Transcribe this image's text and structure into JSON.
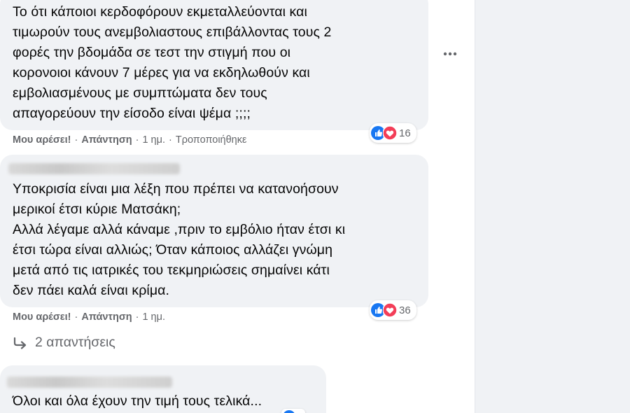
{
  "comments": [
    {
      "text": "Το ότι κάποιοι κερδοφόρουν εκμεταλλεύονται και\nτιμωρούν τους ανεμβολιαστους επιβάλλοντας τους 2\nφορές την βδομάδα σε τεστ την στιγμή που οι\nκορονοιοι κάνουν 7 μέρες για να εκδηλωθούν και\nεμβολιασμένους με συμπτώματα δεν τους\nαπαγορεύουν την είσοδο είναι ψέμα ;;;;",
      "reaction_count": "16",
      "like_label": "Μου αρέσει!",
      "reply_label": "Απάντηση",
      "time": "1 ημ.",
      "edited": "Τροποποιήθηκε"
    },
    {
      "text": "Υποκρισία είναι μια λέξη που πρέπει να κατανοήσουν\nμερικοί έτσι κύριε Ματσάκη;\nΑλλά λέγαμε αλλά κάναμε ,πριν το εμβόλιο ήταν έτσι κι\nέτσι τώρα είναι αλλιώς; Όταν κάποιος αλλάζει γνώμη\nμετά από τις ιατρικές του τεκμηριώσεις σημαίνει κάτι\nδεν πάει καλά είναι κρίμα.",
      "reaction_count": "36",
      "like_label": "Μου αρέσει!",
      "reply_label": "Απάντηση",
      "time": "1 ημ.",
      "replies_label": "2 απαντήσεις"
    },
    {
      "text": "Όλοι και όλα έχουν την τιμή τους τελικά..."
    }
  ],
  "icons": {
    "like": "like-reaction-icon",
    "love": "love-reaction-icon",
    "more": "more-options-icon",
    "reply_arrow": "reply-arrow-icon"
  },
  "colors": {
    "like_blue": "#1877f2",
    "love_red": "#f33e58",
    "secondary_text": "#65676b",
    "bubble_bg": "#f0f2f5"
  }
}
